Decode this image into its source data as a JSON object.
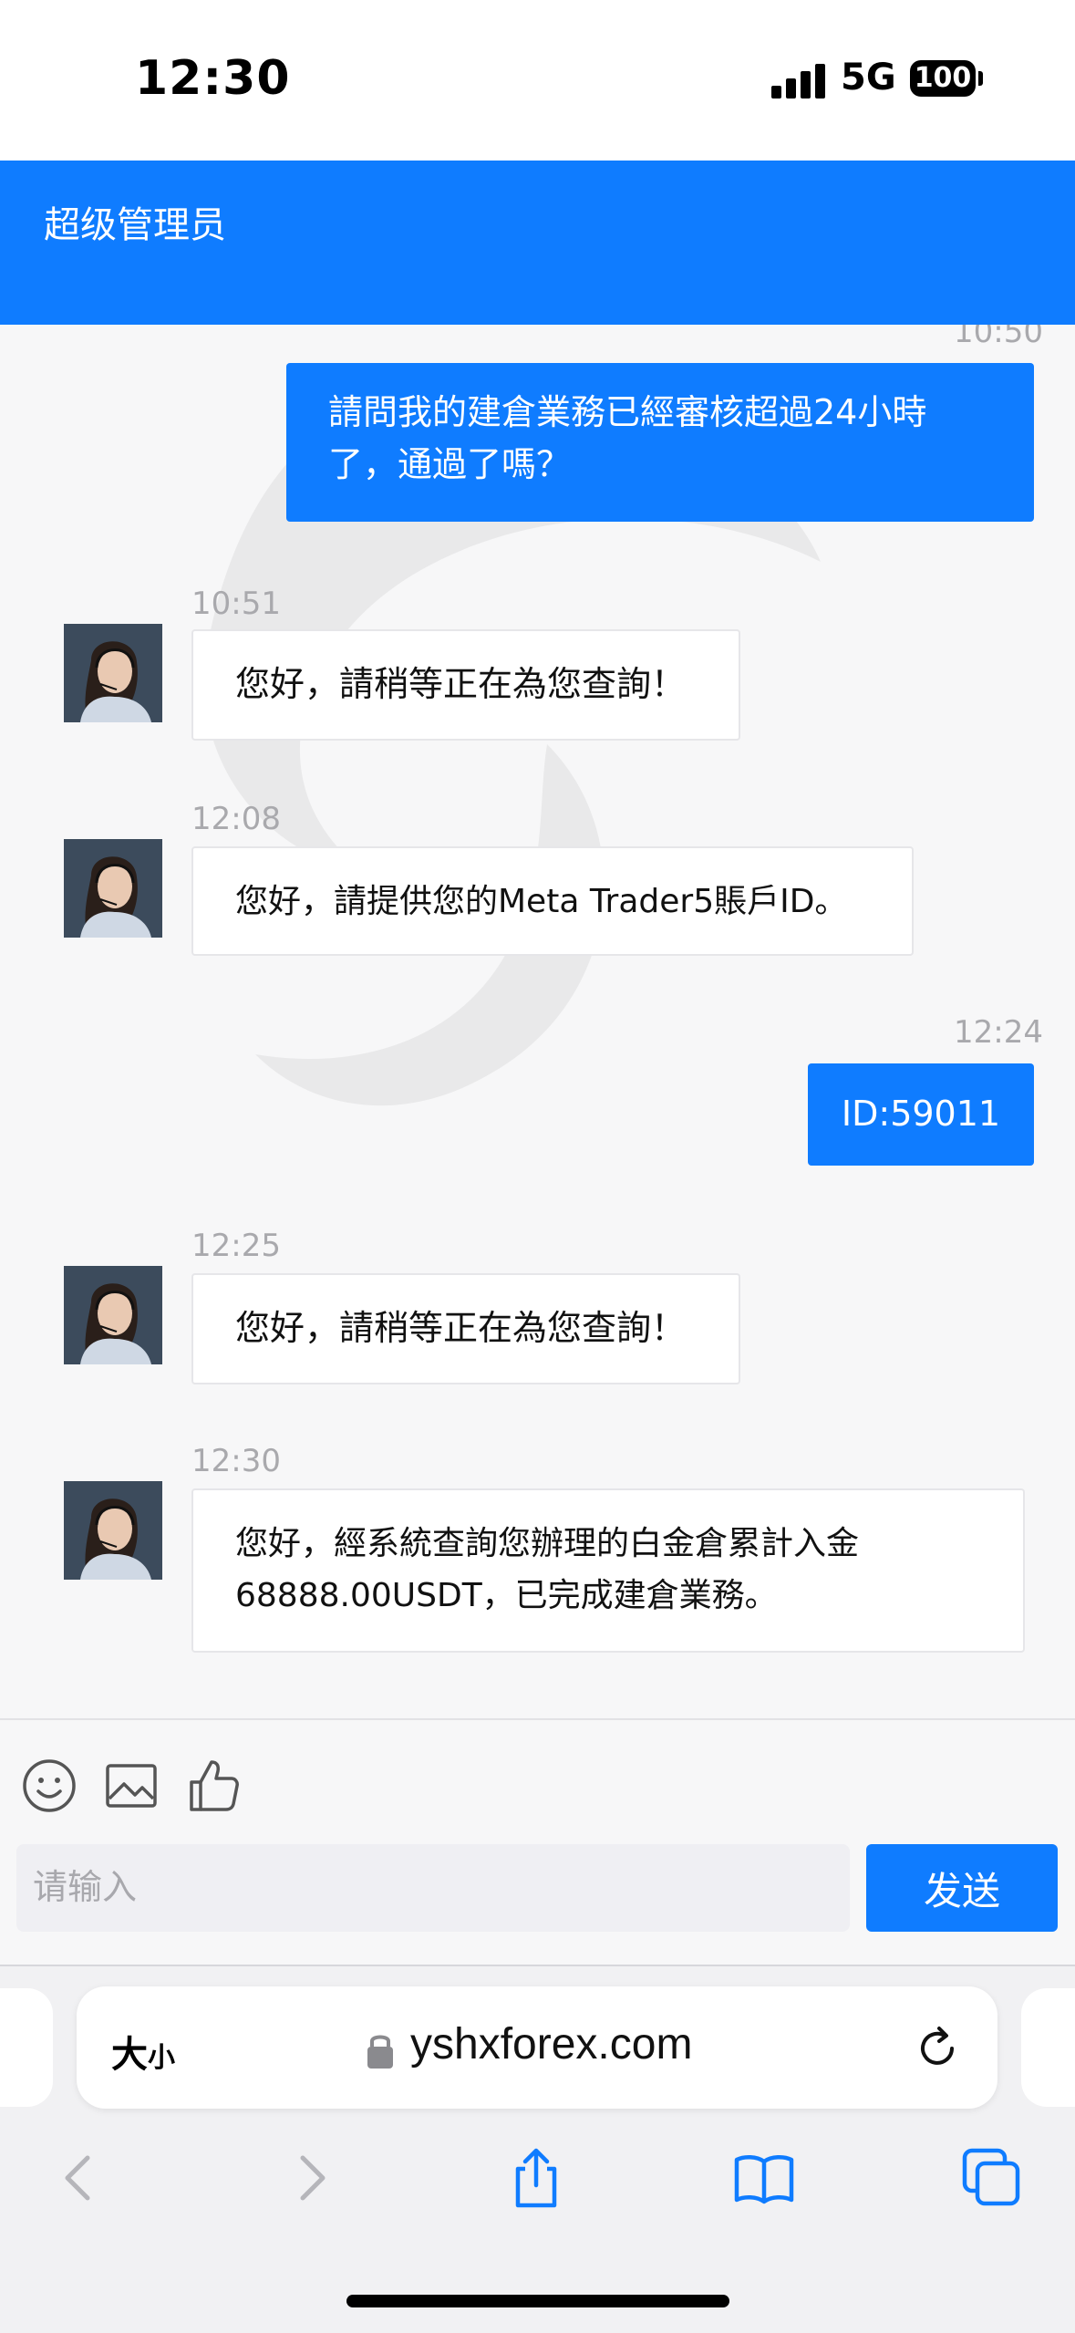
{
  "status_bar": {
    "time": "12:30",
    "network": "5G",
    "battery": "100"
  },
  "header": {
    "title": "超级管理员"
  },
  "messages": [
    {
      "dir": "out",
      "time": "10:50",
      "text": "請問我的建倉業務已經審核超過24小時了，通過了嗎？",
      "lines": [
        "請問我的建倉業務已經審核超過24小時",
        "了，通過了嗎？"
      ]
    },
    {
      "dir": "in",
      "time": "10:51",
      "text": "您好，請稍等正在為您查詢！"
    },
    {
      "dir": "in",
      "time": "12:08",
      "text": "您好，請提供您的Meta Trader5賬戶ID。"
    },
    {
      "dir": "out",
      "time": "12:24",
      "text": "ID:59011"
    },
    {
      "dir": "in",
      "time": "12:25",
      "text": "您好，請稍等正在為您查詢！"
    },
    {
      "dir": "in",
      "time": "12:30",
      "text": "您好，經系統查詢您辦理的白金倉累計入金68888.00USDT，已完成建倉業務。",
      "lines": [
        "您好，經系統查詢您辦理的白金倉累計入金",
        "68888.00USDT，已完成建倉業務。"
      ]
    }
  ],
  "composer": {
    "placeholder": "请输入",
    "send_label": "发送",
    "icons": [
      "emoji-icon",
      "image-icon",
      "thumbs-up-icon"
    ]
  },
  "browser": {
    "text_size_label": "大小",
    "text_size_big": "大",
    "text_size_small": "小",
    "url": "yshxforex.com",
    "icons": [
      "lock-icon",
      "reload-icon",
      "back-icon",
      "forward-icon",
      "share-icon",
      "bookmarks-icon",
      "tabs-icon"
    ]
  },
  "colors": {
    "accent": "#0f7cff",
    "background": "#f7f7f8",
    "timestamp": "#a9a9ad"
  }
}
